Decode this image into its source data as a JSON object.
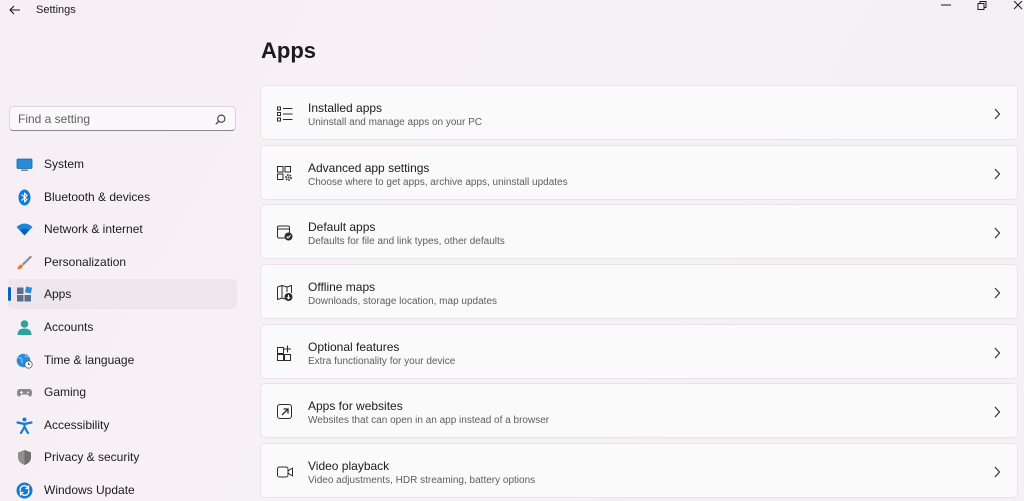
{
  "window": {
    "title": "Settings",
    "controls": [
      "minimize-icon",
      "maximize-icon",
      "close-icon"
    ]
  },
  "search": {
    "placeholder": "Find a setting",
    "value": ""
  },
  "sidebar": {
    "items": [
      {
        "label": "System",
        "icon": "monitor-icon"
      },
      {
        "label": "Bluetooth & devices",
        "icon": "bluetooth-icon"
      },
      {
        "label": "Network & internet",
        "icon": "wifi-icon"
      },
      {
        "label": "Personalization",
        "icon": "brush-icon"
      },
      {
        "label": "Apps",
        "icon": "apps-icon",
        "selected": true
      },
      {
        "label": "Accounts",
        "icon": "person-icon"
      },
      {
        "label": "Time & language",
        "icon": "globe-clock-icon"
      },
      {
        "label": "Gaming",
        "icon": "gamepad-icon"
      },
      {
        "label": "Accessibility",
        "icon": "accessibility-icon"
      },
      {
        "label": "Privacy & security",
        "icon": "shield-icon"
      },
      {
        "label": "Windows Update",
        "icon": "update-icon"
      }
    ]
  },
  "main": {
    "title": "Apps",
    "cards": [
      {
        "title": "Installed apps",
        "subtitle": "Uninstall and manage apps on your PC",
        "icon": "list-icon"
      },
      {
        "title": "Advanced app settings",
        "subtitle": "Choose where to get apps, archive apps, uninstall updates",
        "icon": "app-settings-icon"
      },
      {
        "title": "Default apps",
        "subtitle": "Defaults for file and link types, other defaults",
        "icon": "default-apps-icon"
      },
      {
        "title": "Offline maps",
        "subtitle": "Downloads, storage location, map updates",
        "icon": "map-icon"
      },
      {
        "title": "Optional features",
        "subtitle": "Extra functionality for your device",
        "icon": "features-grid-icon"
      },
      {
        "title": "Apps for websites",
        "subtitle": "Websites that can open in an app instead of a browser",
        "icon": "open-in-app-icon"
      },
      {
        "title": "Video playback",
        "subtitle": "Video adjustments, HDR streaming, battery options",
        "icon": "video-camera-icon"
      }
    ]
  },
  "colors": {
    "accent": "#0067c0",
    "background": "#f6f0f6",
    "card": "#fbfafb"
  }
}
